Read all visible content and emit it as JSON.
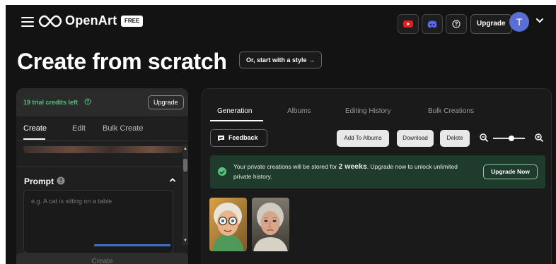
{
  "header": {
    "brand": "OpenArt",
    "plan_badge": "FREE",
    "upgrade_label": "Upgrade",
    "avatar_initial": "T",
    "icons": [
      "menu-icon",
      "openart-logo-icon",
      "youtube-icon",
      "discord-icon",
      "help-icon",
      "chevron-down-icon"
    ],
    "colors": {
      "youtube": "#e02020",
      "discord": "#5865f2",
      "avatar": "#5a6fd6"
    }
  },
  "title": {
    "text": "Create from scratch",
    "style_button": "Or, start with a style →"
  },
  "left_panel": {
    "credits": "19 trial credits left",
    "upgrade_label": "Upgrade",
    "tabs": [
      {
        "label": "Create",
        "active": true
      },
      {
        "label": "Edit",
        "active": false
      },
      {
        "label": "Bulk Create",
        "active": false
      }
    ],
    "prompt_label": "Prompt",
    "prompt_placeholder": "e.g. A cat is sitting on a table",
    "create_button": "Create",
    "credit_color": "#4ec27a"
  },
  "right_panel": {
    "tabs": [
      {
        "label": "Generation",
        "active": true
      },
      {
        "label": "Albums",
        "active": false
      },
      {
        "label": "Editing History",
        "active": false
      },
      {
        "label": "Bulk Creations",
        "active": false
      }
    ],
    "feedback_label": "Feedback",
    "actions": [
      "Add To Albums",
      "Download",
      "Delete"
    ],
    "zoom_level_fraction": 0.5,
    "banner": {
      "text_before": "Your private creations will be stored for ",
      "text_bold": "2 weeks",
      "text_after": ". Upgrade now to unlock unlimited private history.",
      "button": "Upgrade Now",
      "bg_color": "#1f3b2b"
    },
    "results": [
      "cartoon-elderly-woman-image",
      "elderly-woman-portrait-image"
    ]
  }
}
